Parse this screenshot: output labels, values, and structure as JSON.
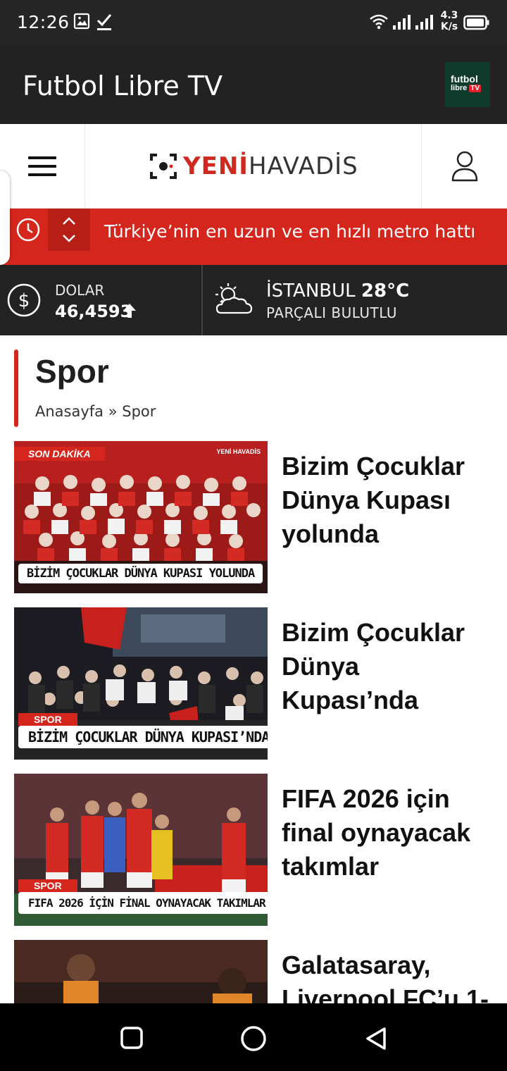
{
  "status_bar": {
    "time": "12:26",
    "net_speed_value": "4.3",
    "net_speed_unit": "K/s",
    "icons": [
      "gallery-icon",
      "check-icon",
      "wifi-icon",
      "signal-icon",
      "signal-icon",
      "battery-icon"
    ]
  },
  "app_bar": {
    "title": "Futbol Libre TV",
    "logo_line1": "futbol",
    "logo_line2": "libre",
    "logo_badge": "TV"
  },
  "site_header": {
    "logo_red": "YENİ",
    "logo_grey": "HAVADİS",
    "icons": [
      "menu-icon",
      "user-icon"
    ]
  },
  "breaking": {
    "headline": "Türkiye’nin en uzun ve en hızlı metro hattı",
    "icons": [
      "clock-icon",
      "chevron-up-icon",
      "chevron-down-icon"
    ]
  },
  "currency": {
    "label": "DOLAR",
    "value": "46,4593",
    "trend": "up"
  },
  "weather": {
    "city": "İSTANBUL",
    "temperature": "28°C",
    "condition": "PARÇALI BULUTLU"
  },
  "page": {
    "title": "Spor",
    "breadcrumb": "Anasayfa » Spor"
  },
  "articles": [
    {
      "title": "Bizim Çocuklar Dünya Kupası yolunda",
      "thumb_tag": "SON DAKİKA",
      "thumb_mark": "YENİ HAVADİS",
      "thumb_caption": "BİZİM ÇOCUKLAR DÜNYA KUPASI YOLUNDA"
    },
    {
      "title": "Bizim Çocuklar Dünya Kupası’nda",
      "thumb_tag": "SPOR",
      "thumb_caption": "BİZİM ÇOCUKLAR DÜNYA KUPASI’NDA"
    },
    {
      "title": "FIFA 2026 için final oynayacak takımlar",
      "thumb_tag": "SPOR",
      "thumb_caption": "FIFA 2026 İÇİN FİNAL OYNAYACAK TAKIMLAR"
    },
    {
      "title": "Galatasaray, Liverpool FC’u 1-"
    }
  ],
  "colors": {
    "brand_red": "#d4261c",
    "dark_bar": "#232323"
  }
}
